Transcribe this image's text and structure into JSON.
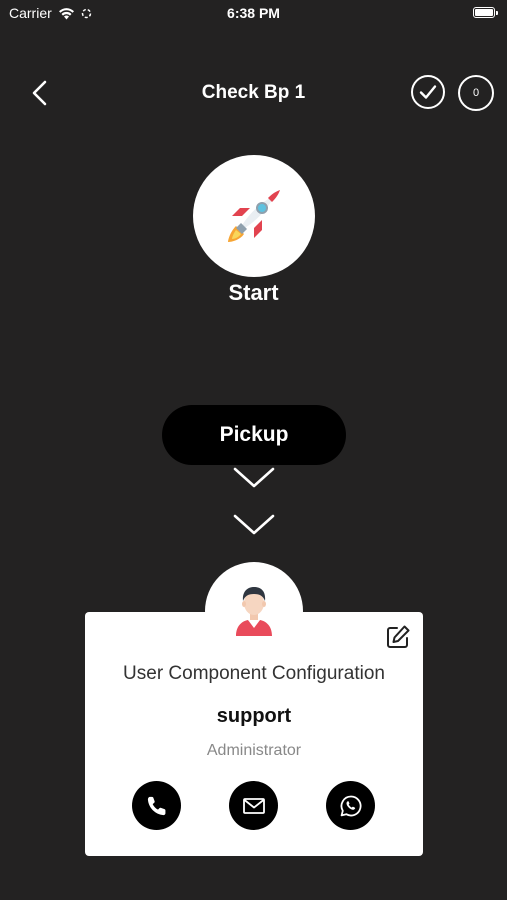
{
  "status_bar": {
    "carrier": "Carrier",
    "time": "6:38 PM"
  },
  "header": {
    "title": "Check Bp 1",
    "count": "0"
  },
  "flow": {
    "start_label": "Start",
    "pickup_label": "Pickup"
  },
  "user_card": {
    "title": "User Component Configuration",
    "name": "support",
    "role": "Administrator"
  },
  "icons": {
    "back": "chevron-left-icon",
    "check": "check-circle-icon",
    "start": "rocket-icon",
    "avatar": "user-avatar-icon",
    "edit": "edit-icon",
    "phone": "phone-icon",
    "email": "mail-icon",
    "whatsapp": "whatsapp-icon"
  },
  "colors": {
    "background": "#232222",
    "pill": "#000000",
    "card": "#ffffff",
    "avatar_shirt": "#e94b5b"
  }
}
